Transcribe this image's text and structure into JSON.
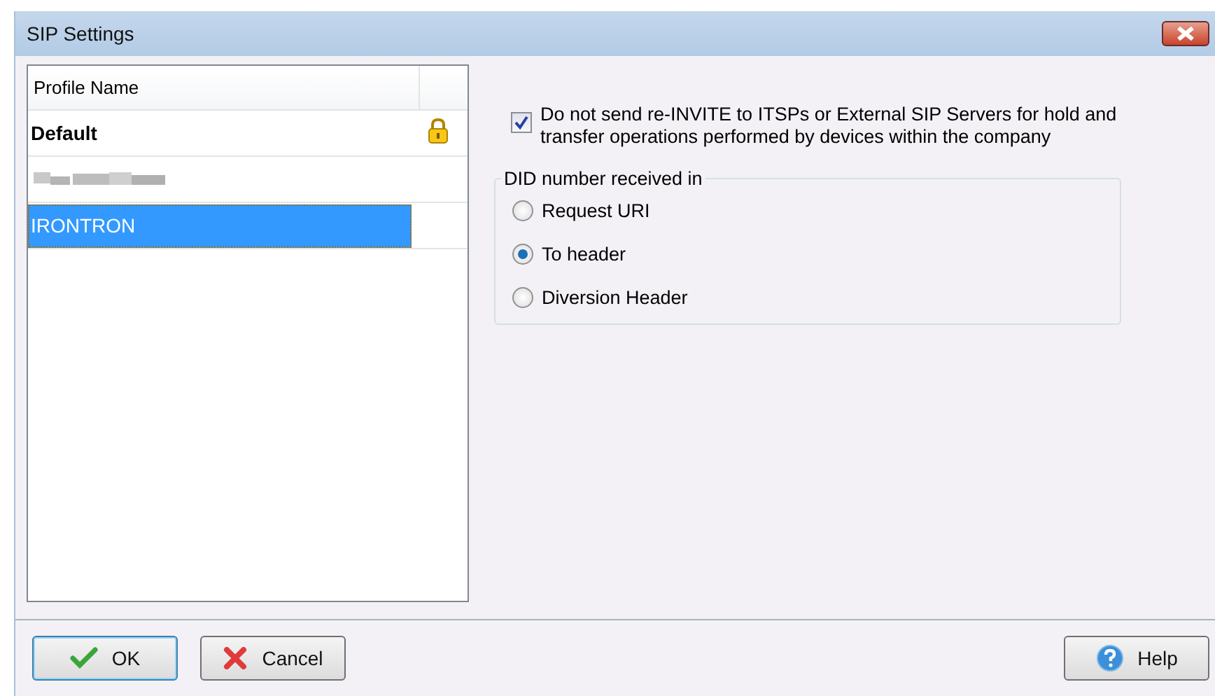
{
  "window": {
    "title": "SIP Settings"
  },
  "profiles": {
    "column": "Profile Name",
    "rows": [
      {
        "kind": "text",
        "name": "Default",
        "bold": true,
        "locked": true,
        "selected": false
      },
      {
        "kind": "redacted",
        "locked": false,
        "selected": false
      },
      {
        "kind": "text",
        "name": "IRONTRON",
        "bold": false,
        "locked": false,
        "selected": true
      }
    ]
  },
  "reinvite": {
    "label": "Do not send re-INVITE to ITSPs or External SIP Servers for hold and transfer operations performed by devices within the company",
    "checked": true
  },
  "did": {
    "title": "DID number received in",
    "options": [
      {
        "label": "Request URI",
        "selected": false
      },
      {
        "label": "To header",
        "selected": true
      },
      {
        "label": "Diversion Header",
        "selected": false
      }
    ]
  },
  "buttons": [
    {
      "kind": "ok",
      "label": "OK",
      "default": true
    },
    {
      "kind": "cancel",
      "label": "Cancel",
      "default": false
    },
    {
      "kind": "help",
      "label": "Help",
      "default": false
    }
  ]
}
